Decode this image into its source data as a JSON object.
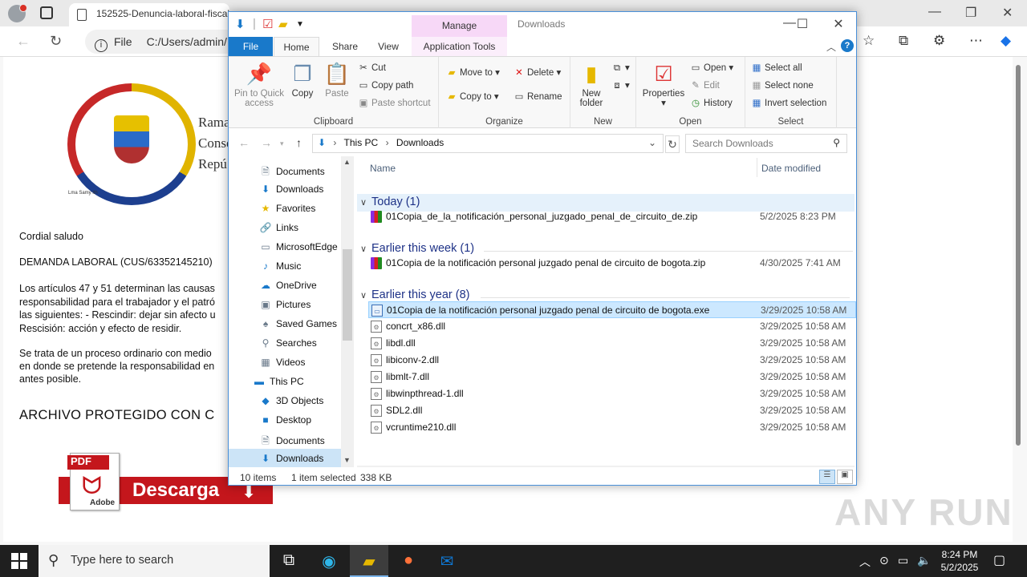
{
  "browser": {
    "tab_title": "152525-Denuncia-laboral-fiscal",
    "url_prefix": "File",
    "url": "C:/Users/admin/"
  },
  "document": {
    "org_lines": [
      "Rama",
      "Conse",
      "Repú"
    ],
    "seal_caption": "Lma Samy lth",
    "greeting": "Cordial saludo",
    "case_title": "DEMANDA LABORAL (CUS/63352145210)",
    "para1": [
      "Los artículos 47 y 51 determinan las causas",
      "responsabilidad para el trabajador y el patró",
      "las siguientes: - Rescindir: dejar sin afecto u",
      "Rescisión: acción y efecto de residir."
    ],
    "para2": [
      "Se trata de un proceso ordinario con medio",
      "en donde se pretende la responsabilidad en",
      "antes posible."
    ],
    "heading": "ARCHIVO PROTEGIDO CON C",
    "pdf_tag": "PDF",
    "pdf_brand": "Adobe",
    "pdf_button": "Descarga",
    "watermark": "ANY RUN"
  },
  "explorer": {
    "manage_label": "Manage",
    "title": "Downloads",
    "tabs": {
      "file": "File",
      "home": "Home",
      "share": "Share",
      "view": "View",
      "app_tools": "Application Tools"
    },
    "clipboard": {
      "label": "Clipboard",
      "pin": "Pin to Quick access",
      "copy": "Copy",
      "paste": "Paste",
      "cut": "Cut",
      "copy_path": "Copy path",
      "paste_shortcut": "Paste shortcut"
    },
    "organize": {
      "label": "Organize",
      "move_to": "Move to",
      "copy_to": "Copy to",
      "delete": "Delete",
      "rename": "Rename"
    },
    "new": {
      "label": "New",
      "new_folder": "New folder"
    },
    "open": {
      "label": "Open",
      "properties": "Properties",
      "open": "Open",
      "edit": "Edit",
      "history": "History"
    },
    "select": {
      "label": "Select",
      "all": "Select all",
      "none": "Select none",
      "invert": "Invert selection"
    },
    "breadcrumb": [
      "This PC",
      "Downloads"
    ],
    "search_placeholder": "Search Downloads",
    "nav_items": [
      {
        "label": "Documents",
        "icon": "documents-icon",
        "glyph": "🗎"
      },
      {
        "label": "Downloads",
        "icon": "downloads-icon",
        "glyph": "⬇"
      },
      {
        "label": "Favorites",
        "icon": "star-icon",
        "glyph": "★"
      },
      {
        "label": "Links",
        "icon": "links-icon",
        "glyph": "🔗"
      },
      {
        "label": "MicrosoftEdge",
        "icon": "folder-icon",
        "glyph": "▭"
      },
      {
        "label": "Music",
        "icon": "music-icon",
        "glyph": "♪"
      },
      {
        "label": "OneDrive",
        "icon": "cloud-icon",
        "glyph": "☁"
      },
      {
        "label": "Pictures",
        "icon": "pictures-icon",
        "glyph": "▣"
      },
      {
        "label": "Saved Games",
        "icon": "games-icon",
        "glyph": "♠"
      },
      {
        "label": "Searches",
        "icon": "search-icon",
        "glyph": "⚲"
      },
      {
        "label": "Videos",
        "icon": "videos-icon",
        "glyph": "▦"
      },
      {
        "label": "This PC",
        "icon": "computer-icon",
        "glyph": "▬"
      },
      {
        "label": "3D Objects",
        "icon": "cube-icon",
        "glyph": "◆"
      },
      {
        "label": "Desktop",
        "icon": "desktop-icon",
        "glyph": "■"
      },
      {
        "label": "Documents",
        "icon": "documents-icon",
        "glyph": "🗎"
      },
      {
        "label": "Downloads",
        "icon": "downloads-icon",
        "glyph": "⬇"
      }
    ],
    "columns": {
      "name": "Name",
      "date": "Date modified"
    },
    "groups": [
      {
        "title": "Today (1)",
        "files": [
          {
            "name": "01Copia_de_la_notificación_personal_juzgado_penal_de_circuito_de.zip",
            "date": "5/2/2025 8:23 PM",
            "type": "zip"
          }
        ]
      },
      {
        "title": "Earlier this week (1)",
        "files": [
          {
            "name": "01Copia de la notificación personal juzgado penal de circuito de bogota.zip",
            "date": "4/30/2025 7:41 AM",
            "type": "zip"
          }
        ]
      },
      {
        "title": "Earlier this year (8)",
        "files": [
          {
            "name": "01Copia de la notificación personal juzgado penal de circuito de bogota.exe",
            "date": "3/29/2025 10:58 AM",
            "type": "exe",
            "selected": true
          },
          {
            "name": "concrt_x86.dll",
            "date": "3/29/2025 10:58 AM",
            "type": "dll"
          },
          {
            "name": "libdl.dll",
            "date": "3/29/2025 10:58 AM",
            "type": "dll"
          },
          {
            "name": "libiconv-2.dll",
            "date": "3/29/2025 10:58 AM",
            "type": "dll"
          },
          {
            "name": "libmlt-7.dll",
            "date": "3/29/2025 10:58 AM",
            "type": "dll"
          },
          {
            "name": "libwinpthread-1.dll",
            "date": "3/29/2025 10:58 AM",
            "type": "dll"
          },
          {
            "name": "SDL2.dll",
            "date": "3/29/2025 10:58 AM",
            "type": "dll"
          },
          {
            "name": "vcruntime210.dll",
            "date": "3/29/2025 10:58 AM",
            "type": "dll"
          }
        ]
      }
    ],
    "status": {
      "count": "10 items",
      "selected": "1 item selected",
      "size": "338 KB"
    }
  },
  "taskbar": {
    "search_placeholder": "Type here to search",
    "time": "8:24 PM",
    "date": "5/2/2025"
  }
}
